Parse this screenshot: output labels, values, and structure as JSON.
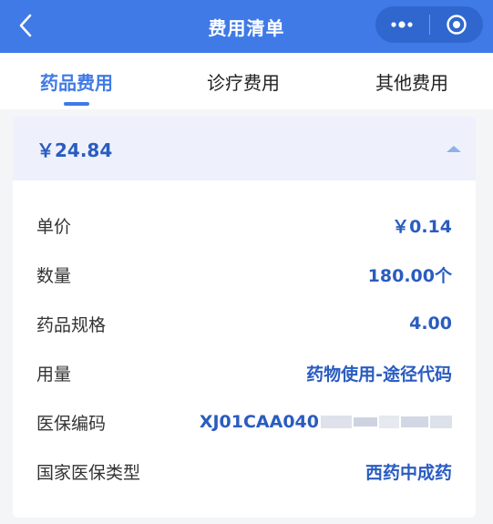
{
  "header": {
    "title": "费用清单"
  },
  "tabs": [
    {
      "label": "药品费用",
      "active": true
    },
    {
      "label": "诊疗费用",
      "active": false
    },
    {
      "label": "其他费用",
      "active": false
    }
  ],
  "card": {
    "total": "￥24.84",
    "expanded": true,
    "rows": [
      {
        "label": "单价",
        "value": "￥0.14"
      },
      {
        "label": "数量",
        "value": "180.00个"
      },
      {
        "label": "药品规格",
        "value": "4.00"
      },
      {
        "label": "用量",
        "value": "药物使用-途径代码"
      },
      {
        "label": "医保编码",
        "value": "XJ01CAA040"
      },
      {
        "label": "国家医保类型",
        "value": "西药中成药"
      }
    ]
  },
  "colors": {
    "primary": "#3f7ae6",
    "value_text": "#2a5cc0",
    "card_head_bg": "#eef1fc"
  }
}
